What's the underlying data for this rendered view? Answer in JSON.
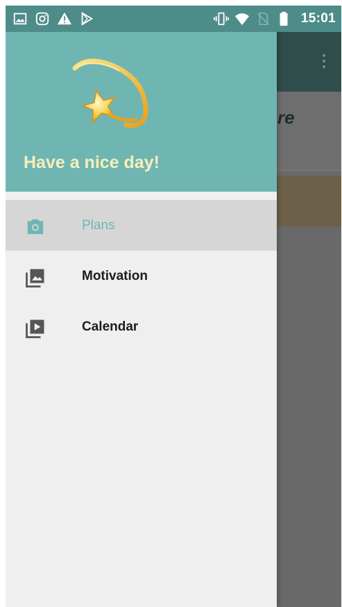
{
  "status_bar": {
    "time": "15:01",
    "left_icons": [
      "image-icon",
      "instagram-icon",
      "warning-icon",
      "play-store-icon"
    ],
    "right_icons": [
      "vibrate-icon",
      "wifi-icon",
      "no-sim-icon",
      "battery-icon"
    ]
  },
  "drawer": {
    "header_title": "Have a nice day!",
    "header_image": "shooting-star-icon",
    "items": [
      {
        "label": "Plans",
        "icon": "camera-icon",
        "selected": true
      },
      {
        "label": "Motivation",
        "icon": "photo-library-icon",
        "selected": false
      },
      {
        "label": "Calendar",
        "icon": "video-library-icon",
        "selected": false
      }
    ]
  },
  "background": {
    "visible_text": "re"
  },
  "colors": {
    "accent": "#6fb6b3",
    "status_bar": "#4e8c89",
    "header_text": "#f7efb9",
    "selected_bg": "#d6d6d6"
  }
}
